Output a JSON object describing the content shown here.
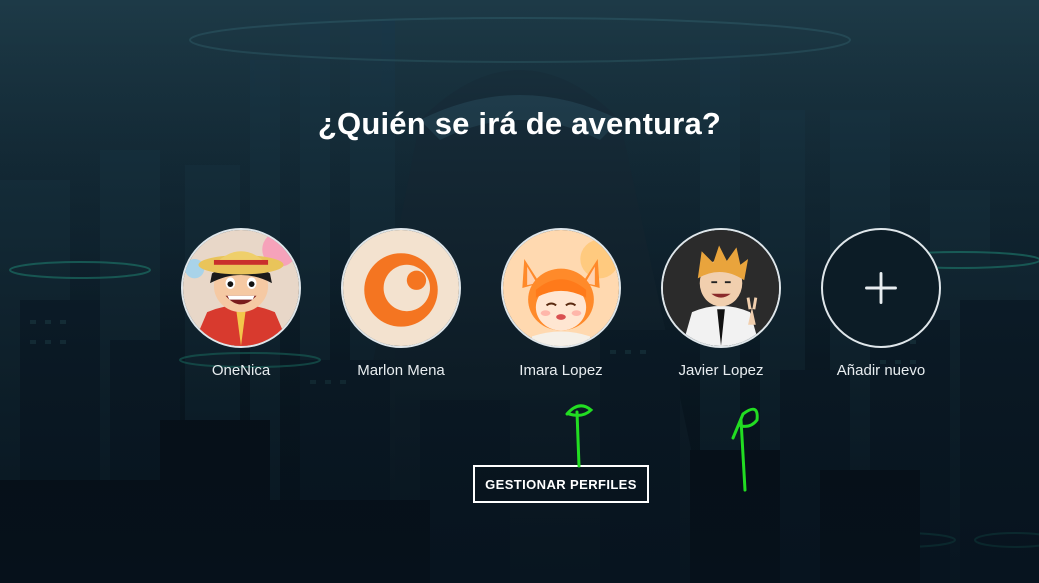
{
  "page": {
    "title": "¿Quién se irá de aventura?",
    "manage_label": "GESTIONAR PERFILES"
  },
  "profiles": [
    {
      "name": "OneNica",
      "avatar": "luffy-avatar"
    },
    {
      "name": "Marlon Mena",
      "avatar": "crunchyroll-logo-avatar"
    },
    {
      "name": "Imara Lopez",
      "avatar": "fox-girl-avatar"
    },
    {
      "name": "Javier Lopez",
      "avatar": "denji-avatar"
    },
    {
      "name": "Añadir nuevo",
      "avatar": "plus-icon"
    }
  ],
  "colors": {
    "background": "#0b1a24",
    "text": "#ffffff",
    "accent_orange": "#f47521",
    "annotation_green": "#22dd22"
  }
}
